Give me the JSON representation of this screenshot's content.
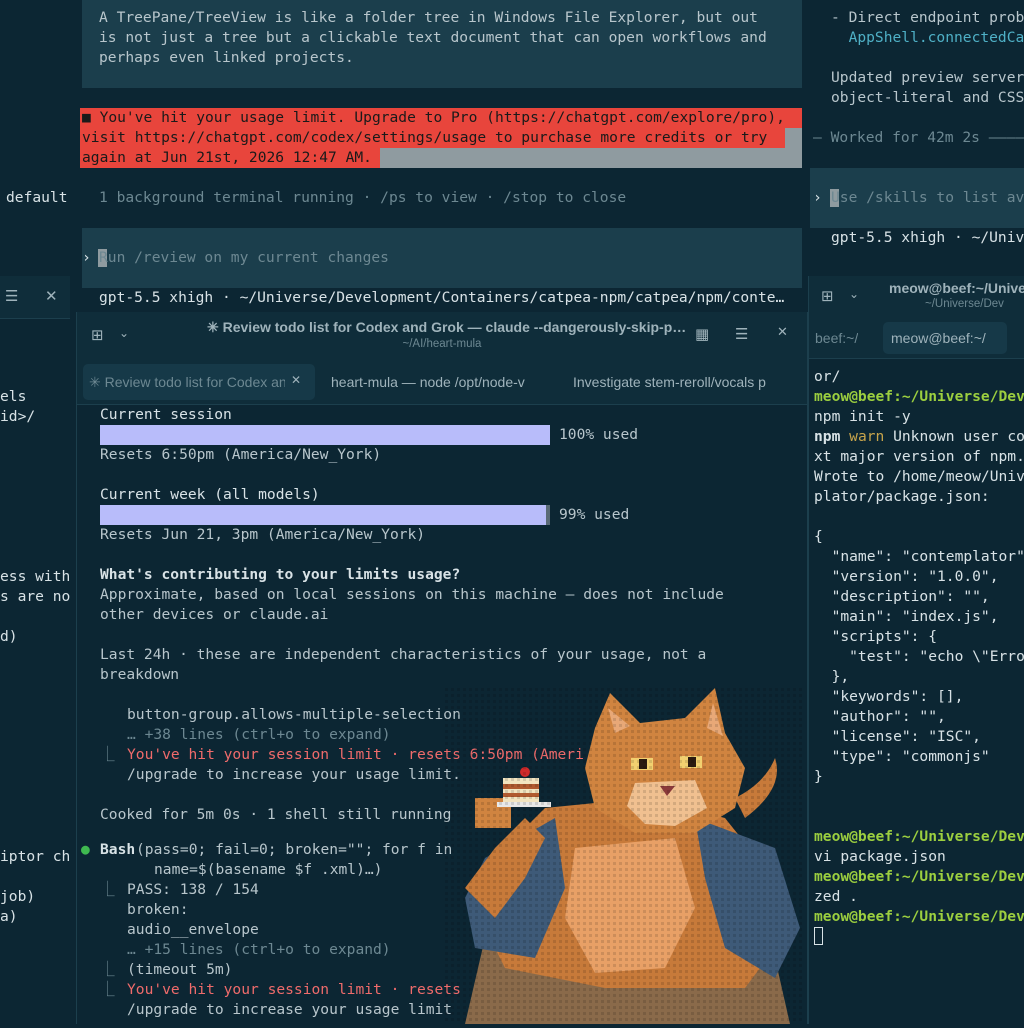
{
  "left_strip": {
    "lines": [
      "default",
      "els",
      "id>/",
      "ess with",
      "s are no",
      "d)",
      "iptor ch",
      "job)",
      "a)"
    ]
  },
  "top_pane": {
    "info_lines": [
      "A TreePane/TreeView is like a folder tree in Windows File Explorer, but out",
      "is not just a tree but a clickable text document that can open workflows and",
      "perhaps even linked projects."
    ],
    "error_lines": [
      "■ You've hit your usage limit. Upgrade to Pro (https://chatgpt.com/explore/pro),",
      "visit https://chatgpt.com/codex/settings/usage to purchase more credits or try",
      "again at Jun 21st, 2026 12:47 AM."
    ],
    "background_status": "1 background terminal running · /ps to view · /stop to close",
    "prompt_char": "›",
    "input_placeholder": "Run /review on my current changes",
    "status_line": "gpt-5.5 xhigh · ~/Universe/Development/Containers/catpea-npm/catpea/npm/conte…"
  },
  "main_window": {
    "title": "✳ Review todo list for Codex and Grok — claude --dangerously-skip-p…",
    "subtitle": "~/AI/heart-mula",
    "tabs": [
      {
        "label": "✳ Review todo list for Codex and Grok"
      },
      {
        "label": "heart-mula — node /opt/node-v"
      },
      {
        "label": "Investigate stem-reroll/vocals p"
      }
    ],
    "usage": {
      "session_label": "Current session",
      "session_percent": 100,
      "session_used": "100% used",
      "session_reset": "Resets 6:50pm (America/New_York)",
      "week_label": "Current week (all models)",
      "week_percent": 99,
      "week_used": "99% used",
      "week_reset": "Resets Jun 21, 3pm (America/New_York)"
    },
    "contrib_heading": "What's contributing to your limits usage?",
    "contrib_lines": [
      "Approximate, based on local sessions on this machine — does not include",
      "other devices or claude.ai"
    ],
    "last24_lines": [
      "Last 24h · these are independent characteristics of your usage, not a",
      "breakdown"
    ],
    "group_name": "button-group.allows-multiple-selection",
    "expand_more_1": "… +38 lines (ctrl+o to expand)",
    "limit_msg_1": "You've hit your session limit · resets 6:50pm (Ameri",
    "upgrade_1": "/upgrade to increase your usage limit.",
    "cooked": "Cooked for 5m 0s · 1 shell still running",
    "bash_tool": "Bash",
    "bash_cmd_1": "(pass=0; fail=0; broken=\"\"; for f in",
    "bash_cmd_2": "name=$(basename $f .xml)…)",
    "pass_line": "PASS: 138 / 154",
    "broken_line": "broken:",
    "audio_line": "audio__envelope",
    "expand_more_2": "… +15 lines (ctrl+o to expand)",
    "timeout_line": "(timeout 5m)",
    "limit_msg_2": "You've hit your session limit · resets",
    "upgrade_2": "/upgrade to increase your usage limit"
  },
  "right_top": {
    "lines": [
      "- Direct endpoint prob",
      "  AppShell.connectedCa",
      "",
      "Updated preview server",
      "object-literal and CSS",
      "",
      "— Worked for 42m 2s ————"
    ],
    "prompt_char": "›",
    "input_placeholder": "Use /skills to list av",
    "status_line": "gpt-5.5 xhigh · ~/Univ"
  },
  "right_window": {
    "title": "meow@beef:~/Universe",
    "subtitle": "~/Universe/Dev",
    "tabs": [
      {
        "label": "beef:~/"
      },
      {
        "label": "meow@beef:~/"
      }
    ],
    "lines": [
      {
        "t": "or/",
        "c": "wht"
      },
      {
        "t": "meow@beef:~/Universe/Dev",
        "c": "green"
      },
      {
        "t": "npm init -y",
        "c": "wht"
      },
      {
        "t": "npm warn Unknown user co",
        "c": "npmwarn"
      },
      {
        "t": "xt major version of npm.",
        "c": "wht"
      },
      {
        "t": "Wrote to /home/meow/Univ",
        "c": "wht"
      },
      {
        "t": "plator/package.json:",
        "c": "wht"
      },
      {
        "t": "",
        "c": "wht"
      },
      {
        "t": "{",
        "c": "wht"
      },
      {
        "t": "  \"name\": \"contemplator\"",
        "c": "wht"
      },
      {
        "t": "  \"version\": \"1.0.0\",",
        "c": "wht"
      },
      {
        "t": "  \"description\": \"\",",
        "c": "wht"
      },
      {
        "t": "  \"main\": \"index.js\",",
        "c": "wht"
      },
      {
        "t": "  \"scripts\": {",
        "c": "wht"
      },
      {
        "t": "    \"test\": \"echo \\\"Erro",
        "c": "wht"
      },
      {
        "t": "  },",
        "c": "wht"
      },
      {
        "t": "  \"keywords\": [],",
        "c": "wht"
      },
      {
        "t": "  \"author\": \"\",",
        "c": "wht"
      },
      {
        "t": "  \"license\": \"ISC\",",
        "c": "wht"
      },
      {
        "t": "  \"type\": \"commonjs\"",
        "c": "wht"
      },
      {
        "t": "}",
        "c": "wht"
      },
      {
        "t": "",
        "c": "wht"
      },
      {
        "t": "",
        "c": "wht"
      },
      {
        "t": "meow@beef:~/Universe/Dev",
        "c": "green"
      },
      {
        "t": "vi package.json",
        "c": "wht"
      },
      {
        "t": "meow@beef:~/Universe/Dev",
        "c": "green"
      },
      {
        "t": "zed .",
        "c": "wht"
      },
      {
        "t": "meow@beef:~/Universe/Dev",
        "c": "green"
      }
    ]
  },
  "colors": {
    "background": "#0c2633",
    "error_bg": "#e8453c",
    "usage_bar": "#b8bcfa",
    "prompt_green": "#9ccf3f",
    "limit_red": "#ef6b6b"
  }
}
